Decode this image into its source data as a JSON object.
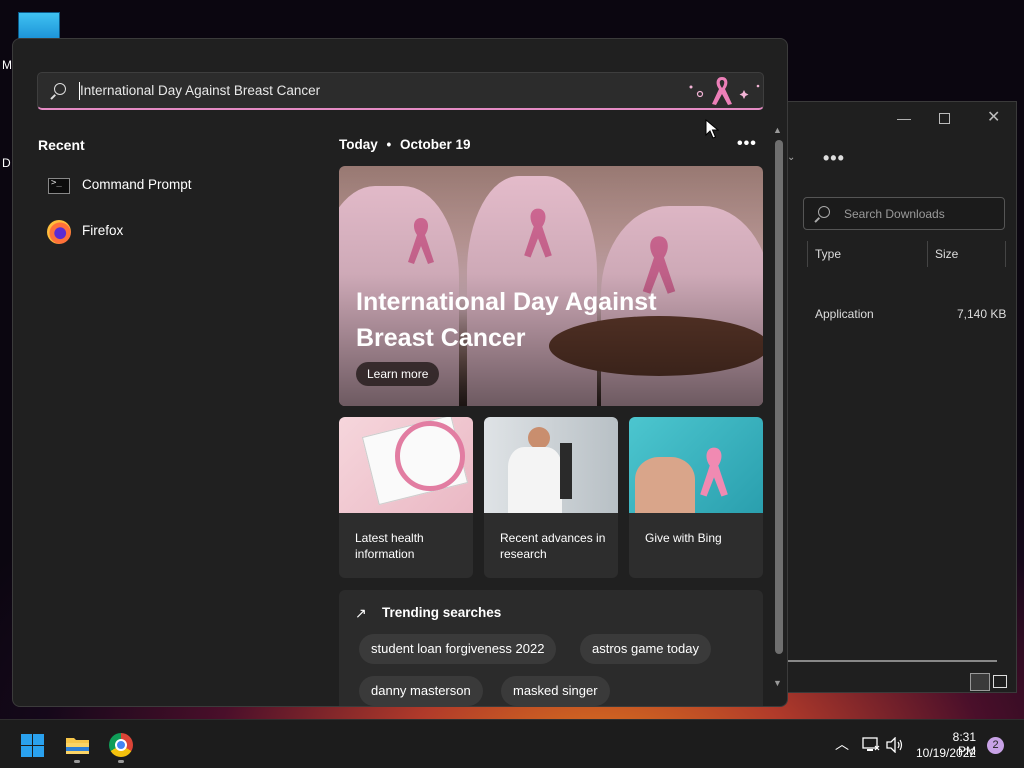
{
  "desktop": {
    "icon_label_partial_1": "M",
    "icon_label_partial_2": "D"
  },
  "explorer": {
    "search_placeholder": "Search Downloads",
    "columns": [
      "Type",
      "Size"
    ],
    "row": {
      "type": "Application",
      "size": "7,140 KB"
    }
  },
  "search": {
    "query": "International Day Against Breast Cancer"
  },
  "recent": {
    "title": "Recent",
    "items": [
      {
        "label": "Command Prompt",
        "icon": "command-prompt-icon"
      },
      {
        "label": "Firefox",
        "icon": "firefox-icon"
      }
    ]
  },
  "today": {
    "label": "Today",
    "separator": "•",
    "date": "October 19",
    "more_label": "•••"
  },
  "hero": {
    "title": "International Day Against Breast Cancer",
    "button": "Learn more"
  },
  "cards": [
    {
      "label": "Latest health information"
    },
    {
      "label": "Recent advances in research"
    },
    {
      "label": "Give with Bing"
    }
  ],
  "trending": {
    "title": "Trending searches",
    "chips": [
      "student loan forgiveness 2022",
      "astros game today",
      "danny masterson",
      "masked singer"
    ]
  },
  "taskbar": {
    "time": "8:31 PM",
    "date": "10/19/2022",
    "notification_count": "2"
  },
  "colors": {
    "accent": "#e58cc5",
    "panel_bg": "#202020",
    "windows_blue": "#2aa1ee"
  }
}
